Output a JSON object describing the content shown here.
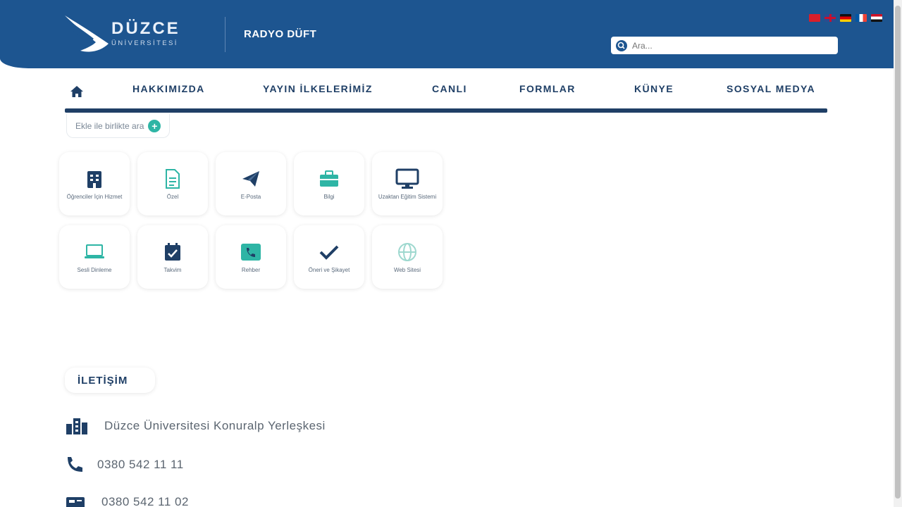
{
  "header": {
    "logo_title": "DÜZCE",
    "logo_subtitle": "ÜNİVERSİTESİ",
    "unit_name": "RADYO DÜFT",
    "search_placeholder": "Ara...",
    "languages": [
      "tr",
      "en",
      "de",
      "fr",
      "ar"
    ]
  },
  "nav": {
    "home_icon": "home-icon",
    "items": [
      "HAKKIMIZDA",
      "YAYIN İLKELERİMİZ",
      "CANLI",
      "FORMLAR",
      "KÜNYE",
      "SOSYAL MEDYA"
    ]
  },
  "breadcrumb": {
    "label": "Ekle ile birlikte ara"
  },
  "tiles": [
    {
      "label": "Öğrenciler İçin Hizmet",
      "icon": "building-icon",
      "color": "#1f3f66"
    },
    {
      "label": "Özel",
      "icon": "document-icon",
      "color": "#2eb5a5"
    },
    {
      "label": "E-Posta",
      "icon": "paper-plane-icon",
      "color": "#1f3f66"
    },
    {
      "label": "Bilgi",
      "icon": "briefcase-icon",
      "color": "#2eb5a5"
    },
    {
      "label": "Uzaktan Eğitim Sistemi",
      "icon": "monitor-icon",
      "color": "#1f3f66"
    },
    {
      "label": "Sesli Dinleme",
      "icon": "laptop-icon",
      "color": "#2eb5a5"
    },
    {
      "label": "Takvim",
      "icon": "calendar-check-icon",
      "color": "#1f3f66"
    },
    {
      "label": "Rehber",
      "icon": "phone-book-icon",
      "color": "#2eb5a5"
    },
    {
      "label": "Öneri ve Şikayet",
      "icon": "checkmark-icon",
      "color": "#1f3f66"
    },
    {
      "label": "Web Sitesi",
      "icon": "globe-icon",
      "color": "#9ed8cf"
    }
  ],
  "contact": {
    "title": "İLETİŞİM",
    "address": "Düzce Üniversitesi Konuralp Yerleşkesi",
    "phone": "0380 542 11 11",
    "fax": "0380 542 11 02"
  }
}
